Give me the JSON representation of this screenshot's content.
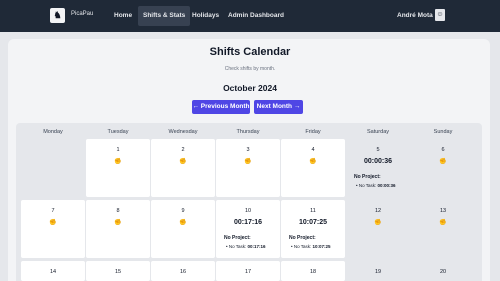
{
  "nav": {
    "brand": "PicaPau",
    "links": [
      "Home",
      "Shifts & Stats",
      "Holidays",
      "Admin Dashboard"
    ],
    "user": "André Mota"
  },
  "page": {
    "title": "Shifts Calendar",
    "subtitle": "Check shifts by month.",
    "month": "October 2024",
    "prev_label": "← Previous Month",
    "next_label": "Next Month →"
  },
  "calendar": {
    "weekdays": [
      "Monday",
      "Tuesday",
      "Wednesday",
      "Thursday",
      "Friday",
      "Saturday",
      "Sunday"
    ],
    "emoji": "✊",
    "project_label": "No Project:",
    "task_prefix": "• No Task:",
    "days": {
      "d1": "1",
      "d2": "2",
      "d3": "3",
      "d4": "4",
      "d5": "5",
      "d6": "6",
      "d7": "7",
      "d8": "8",
      "d9": "9",
      "d10": "10",
      "d11": "11",
      "d12": "12",
      "d13": "13",
      "d14": "14",
      "d15": "15",
      "d16": "16",
      "d17": "17",
      "d18": "18",
      "d19": "19",
      "d20": "20"
    },
    "shifts": {
      "d5": "00:00:36",
      "d10": "00:17:16",
      "d11": "10:07:25"
    }
  }
}
